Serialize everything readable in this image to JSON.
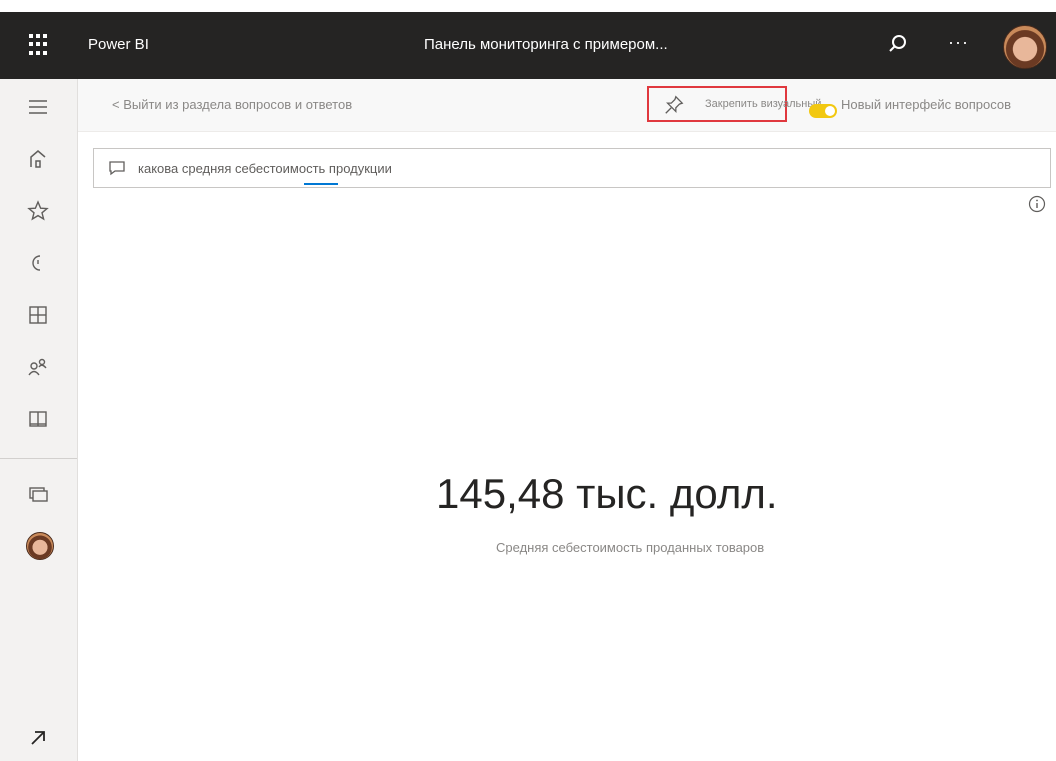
{
  "topbar": {
    "app_name": "Power BI",
    "report_title": "Панель мониторинга с примером...",
    "more_label": "···",
    "icons": [
      "waffle-icon",
      "search-icon",
      "more-icon",
      "user-avatar"
    ]
  },
  "rail": {
    "items": [
      "hamburger-icon",
      "home-icon",
      "favorites-icon",
      "recent-icon",
      "apps-icon",
      "shared-icon",
      "workspaces-icon",
      "monitor-icon",
      "expand-icon"
    ]
  },
  "actionbar": {
    "exit_link": "< Выйти из раздела вопросов и ответов",
    "pin_label": "Закрепить визуальный...",
    "new_qa_label": "Новый интерфейс вопросов",
    "toggle_state": "on"
  },
  "qa": {
    "query": "какова средняя себестоимость продукции"
  },
  "kpi": {
    "value": "145,48 тыс. долл.",
    "label": "Средняя себестоимость проданных товаров"
  },
  "colors": {
    "topbar_bg": "#252423",
    "toggle_accent": "#f2c811",
    "highlight_red": "#e0383e",
    "underline_blue": "#0078d4"
  }
}
